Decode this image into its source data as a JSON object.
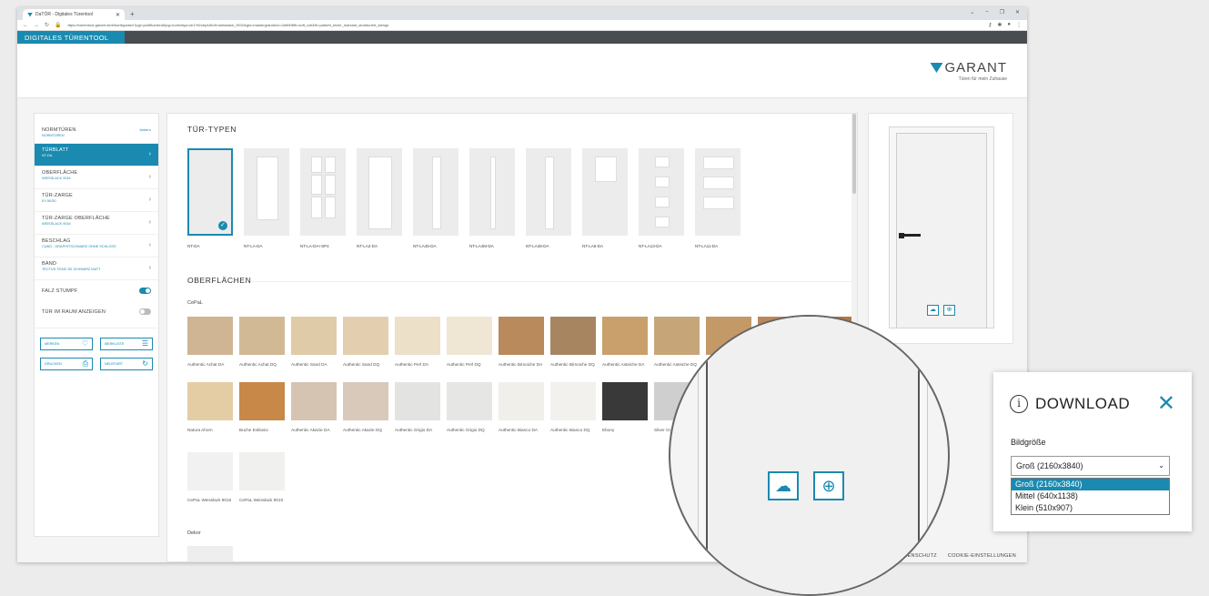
{
  "browser": {
    "tab_title": "DaTÖR - Digitales Türentool",
    "new_tab": "+",
    "url": "https://tuerentool-garant.de/#/konfigurator?pgr=profiltueren&bpg=normdtyp=ulr1%2oep4&hdf=weisslack_9010&gls=mastergrande&r=2a0f4f8fh=soft_coil&fh=parkett_eiche_markant_strukturiert_laengs",
    "window_controls": [
      "⌄",
      "–",
      "❐",
      "✕"
    ]
  },
  "app": {
    "title": "DIGITALES TÜRENTOOL",
    "logo_text": "GARANT",
    "logo_slogan": "Türen für mein Zuhause"
  },
  "sidebar": {
    "top": {
      "title": "NORMTÜREN",
      "sub": "NORMTÜREN",
      "link": "ändern"
    },
    "items": [
      {
        "title": "TÜRBLATT",
        "sub": "NT-DA",
        "active": true
      },
      {
        "title": "OBERFLÄCHE",
        "sub": "WEISSLACK 9016"
      },
      {
        "title": "TÜR-ZARGE",
        "sub": "EY-50/30"
      },
      {
        "title": "TÜR-ZARGE OBERFLÄCHE",
        "sub": "WEISSLACK 9016"
      },
      {
        "title": "BESCHLAG",
        "sub": "CUBO - GRAPHITSCHWARZ OHNE SCHLOSS"
      },
      {
        "title": "BAND",
        "sub": "TECTUS TE340 3D SCHWARZ MATT"
      }
    ],
    "toggles": [
      {
        "label": "FALZ STUMPF",
        "on": true
      },
      {
        "label": "TÜR IM RAUM ANZEIGEN",
        "on": false
      }
    ],
    "buttons": [
      {
        "label": "MERKEN",
        "icon": "heart-icon",
        "glyph": "♡"
      },
      {
        "label": "MERKLISTE",
        "icon": "list-icon",
        "glyph": "☰"
      },
      {
        "label": "DRUCKEN",
        "icon": "printer-icon",
        "glyph": "⎙"
      },
      {
        "label": "NEUSTART",
        "icon": "restart-icon",
        "glyph": "↻"
      }
    ]
  },
  "main": {
    "door_types_heading": "TÜR-TYPEN",
    "door_types": [
      "NT-DA",
      "NT-LA-DA",
      "NT-LA-DA+SP4",
      "NT-LA2-DA",
      "NT-LA45-DA",
      "NT-LA4M-DA",
      "NT-LA48-DA",
      "NT-LA6-DA",
      "NT-LA13-DA",
      "NT-LA11-DA"
    ],
    "surfaces_heading": "OBERFLÄCHEN",
    "group_cepal": "CePaL",
    "swatches_row1": [
      {
        "label": "Authentic Achat DA",
        "color": "#cfb593"
      },
      {
        "label": "Authentic Achat DQ",
        "color": "#d2b995"
      },
      {
        "label": "Authentic Sand DA",
        "color": "#e0cba9"
      },
      {
        "label": "Authentic Sand DQ",
        "color": "#e3cfb0"
      },
      {
        "label": "Authentic Perl DA",
        "color": "#ece0c9"
      },
      {
        "label": "Authentic Perl DQ",
        "color": "#efe6d4"
      },
      {
        "label": "Authentic Birnoiche DA",
        "color": "#b88a5c"
      },
      {
        "label": "Authentic Birnoiche DQ",
        "color": "#a88561"
      },
      {
        "label": "Authentic Asteiche DA",
        "color": "#c9a06b"
      },
      {
        "label": "Authentic Asteiche DQ",
        "color": "#c6a679"
      },
      {
        "label": "",
        "color": "#c39968"
      },
      {
        "label": "",
        "color": "#bb875a"
      },
      {
        "label": "",
        "color": "#b07942"
      }
    ],
    "swatches_row2": [
      {
        "label": "Natura Ahorn",
        "color": "#e4cda5"
      },
      {
        "label": "Buche Exklusiv",
        "color": "#c78848"
      },
      {
        "label": "Authentic Akazie DA",
        "color": "#d6c4b3"
      },
      {
        "label": "Authentic Akazie DQ",
        "color": "#d9c9bb"
      },
      {
        "label": "Authentic Grigio DA",
        "color": "#e3e3e1"
      },
      {
        "label": "Authentic Grigio DQ",
        "color": "#e6e6e4"
      },
      {
        "label": "Authentic Bianco DA",
        "color": "#f0efea"
      },
      {
        "label": "Authentic Bianco DQ",
        "color": "#f2f1ed"
      },
      {
        "label": "Ebony",
        "color": "#393939"
      },
      {
        "label": "Silver Gr",
        "color": "#cfcfcf"
      }
    ],
    "swatches_row3": [
      {
        "label": "CePaL Weisslack 9016",
        "color": "#f1f1f1"
      },
      {
        "label": "CePaL Weisslack 9010",
        "color": "#f0f0ee"
      }
    ],
    "group_dekor": "Dekor"
  },
  "preview": {
    "download_icon": "☁",
    "zoom_icon": "⊕"
  },
  "footer": {
    "links": [
      "ENSCHUTZ",
      "COOKIE-EINSTELLUNGEN"
    ]
  },
  "popup": {
    "info_glyph": "i",
    "title": "DOWNLOAD",
    "close": "✕",
    "label": "Bildgröße",
    "selected": "Groß (2160x3840)",
    "options": [
      "Groß (2160x3840)",
      "Mittel (640x1138)",
      "Klein (510x907)"
    ]
  }
}
